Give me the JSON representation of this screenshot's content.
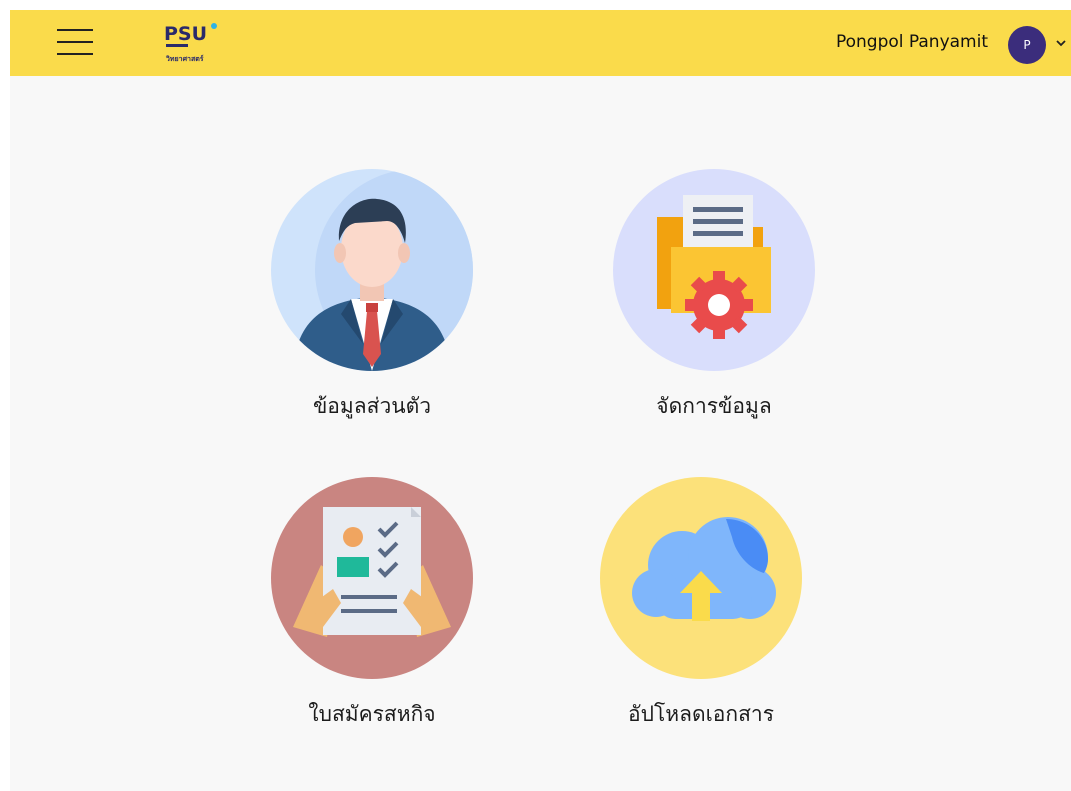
{
  "header": {
    "logo_text": "PSU",
    "logo_subtext": "วิทยาศาสตร์",
    "user_name": "Pongpol Panyamit",
    "avatar_initial": "P"
  },
  "menu": [
    {
      "label": "ข้อมูลส่วนตัว",
      "icon": "person-icon",
      "color": "#cfe3fb"
    },
    {
      "label": "จัดการข้อมูล",
      "icon": "folder-settings-icon",
      "color": "#d9defc"
    },
    {
      "label": "ใบสมัครสหกิจ",
      "icon": "application-form-icon",
      "color": "#c98581"
    },
    {
      "label": "อัปโหลดเอกสาร",
      "icon": "cloud-upload-icon",
      "color": "#fce17a"
    }
  ],
  "colors": {
    "topbar": "#fadb4b",
    "avatar": "#3b2d7c",
    "background": "#f8f8f8"
  }
}
